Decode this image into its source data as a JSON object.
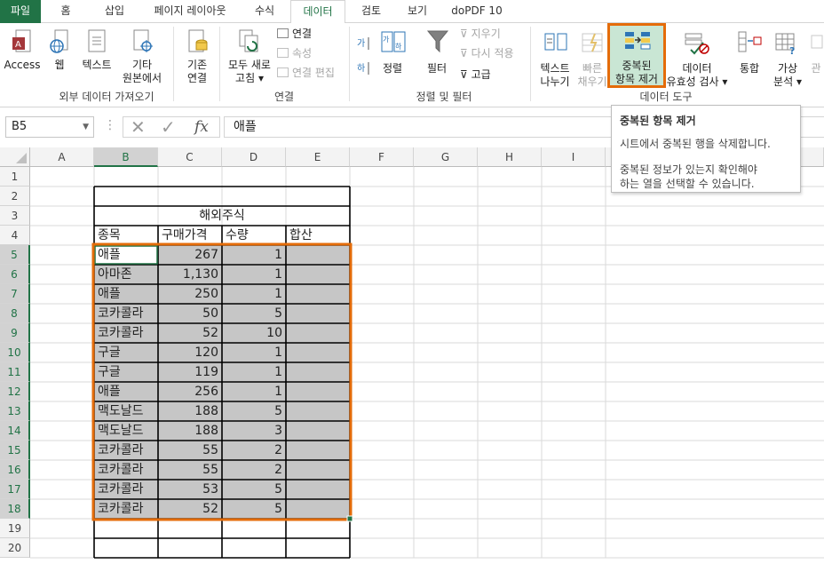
{
  "tabs": [
    {
      "label": "파일"
    },
    {
      "label": "홈"
    },
    {
      "label": "삽입"
    },
    {
      "label": "페이지 레이아웃"
    },
    {
      "label": "수식"
    },
    {
      "label": "데이터"
    },
    {
      "label": "검토"
    },
    {
      "label": "보기"
    },
    {
      "label": "doPDF 10"
    }
  ],
  "ribbon": {
    "external": {
      "access": "Access",
      "web": "웹",
      "text": "텍스트",
      "other": "기타",
      "other2": "원본에서",
      "group": "외부 데이터 가져오기"
    },
    "existing": {
      "l1": "기존",
      "l2": "연결"
    },
    "connections": {
      "refresh1": "모두 새로",
      "refresh2": "고침",
      "connections": "연결",
      "properties": "속성",
      "edit_links": "연결 편집",
      "group": "연결"
    },
    "sort": {
      "sort": "정렬",
      "filter": "필터",
      "clear": "지우기",
      "reapply": "다시 적용",
      "advanced": "고급",
      "group": "정렬 및 필터"
    },
    "tools": {
      "t2c1": "텍스트",
      "t2c2": "나누기",
      "flash1": "빠른",
      "flash2": "채우기",
      "dup1": "중복된",
      "dup2": "항목 제거",
      "valid1": "데이터",
      "valid2": "유효성 검사",
      "consolidate": "통합",
      "whatif1": "가상",
      "whatif2": "분석",
      "rel": "관",
      "group": "데이터 도구"
    }
  },
  "tooltip": {
    "title": "중복된 항목 제거",
    "line1": "시트에서 중복된 행을 삭제합니다.",
    "line2": "중복된 정보가 있는지 확인해야",
    "line3": "하는 열을 선택할 수 있습니다."
  },
  "formula_bar": {
    "name_box": "B5",
    "fx": "fx",
    "value": "애플"
  },
  "columns": [
    "A",
    "B",
    "C",
    "D",
    "E",
    "F",
    "G",
    "H",
    "I"
  ],
  "rows": [
    "1",
    "2",
    "3",
    "4",
    "5",
    "6",
    "7",
    "8",
    "9",
    "10",
    "11",
    "12",
    "13",
    "14",
    "15",
    "16",
    "17",
    "18",
    "19",
    "20"
  ],
  "sheet": {
    "title": "해외주식",
    "headers": [
      "종목",
      "구매가격",
      "수량",
      "합산"
    ],
    "data": [
      [
        "애플",
        "267",
        "1"
      ],
      [
        "아마존",
        "1,130",
        "1"
      ],
      [
        "애플",
        "250",
        "1"
      ],
      [
        "코카콜라",
        "50",
        "5"
      ],
      [
        "코카콜라",
        "52",
        "10"
      ],
      [
        "구글",
        "120",
        "1"
      ],
      [
        "구글",
        "119",
        "1"
      ],
      [
        "애플",
        "256",
        "1"
      ],
      [
        "맥도날드",
        "188",
        "5"
      ],
      [
        "맥도날드",
        "188",
        "3"
      ],
      [
        "코카콜라",
        "55",
        "2"
      ],
      [
        "코카콜라",
        "55",
        "2"
      ],
      [
        "코카콜라",
        "53",
        "5"
      ],
      [
        "코카콜라",
        "52",
        "5"
      ]
    ]
  },
  "colors": {
    "accent": "#217346",
    "highlight": "#e46c0a",
    "selection": "#c6c6c6"
  }
}
